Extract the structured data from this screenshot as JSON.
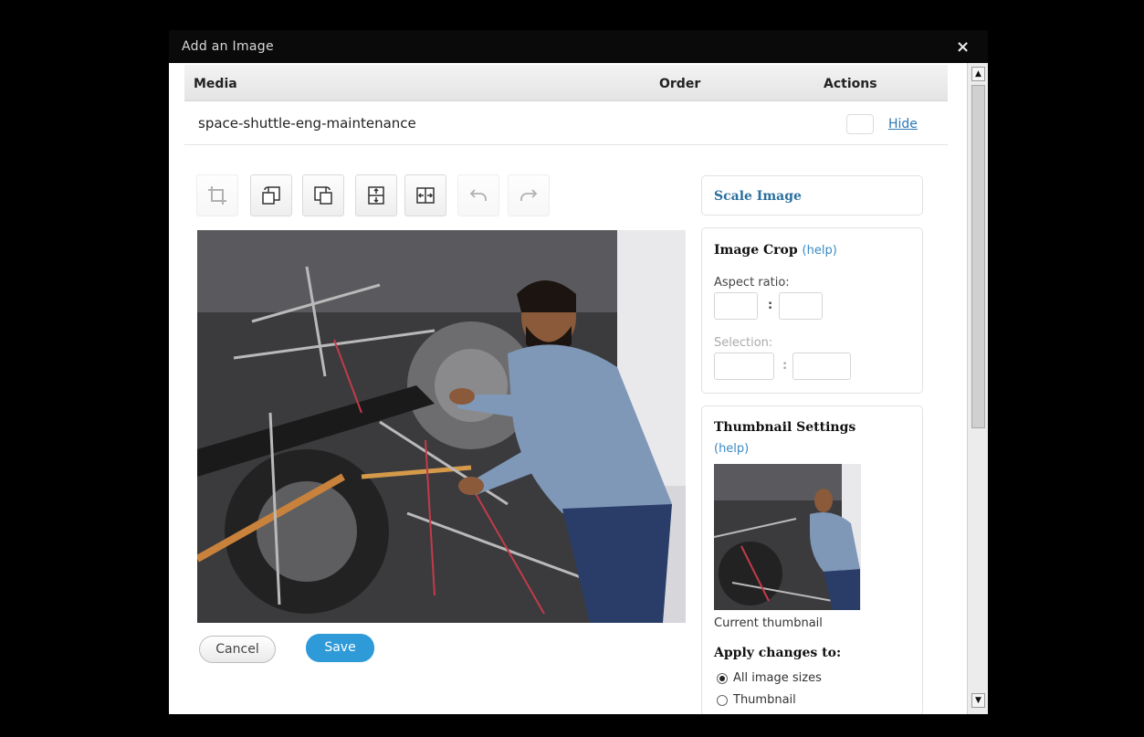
{
  "dialog": {
    "title": "Add an Image",
    "close_icon": "×"
  },
  "table": {
    "columns": {
      "media": "Media",
      "order": "Order",
      "actions": "Actions"
    },
    "row": {
      "filename": "space-shuttle-eng-maintenance",
      "hide_label": "Hide"
    }
  },
  "toolbar": {
    "icons": [
      "crop-icon",
      "rotate-left-icon",
      "rotate-right-icon",
      "flip-vertical-icon",
      "flip-horizontal-icon",
      "undo-icon",
      "redo-icon"
    ]
  },
  "editor": {
    "cancel_label": "Cancel",
    "save_label": "Save"
  },
  "scale_panel": {
    "title": "Scale Image"
  },
  "crop_panel": {
    "title": "Image Crop",
    "help": "(help)",
    "aspect_label": "Aspect ratio:",
    "separator": ":",
    "selection_label": "Selection:"
  },
  "thumb_panel": {
    "title": "Thumbnail Settings",
    "help": "(help)",
    "caption": "Current thumbnail",
    "apply_label": "Apply changes to:",
    "options": [
      "All image sizes",
      "Thumbnail"
    ],
    "selected_option": "All image sizes"
  },
  "colors": {
    "accent": "#2e9ad8",
    "link": "#2b78b8",
    "title_bar": "#0a0a0a"
  }
}
